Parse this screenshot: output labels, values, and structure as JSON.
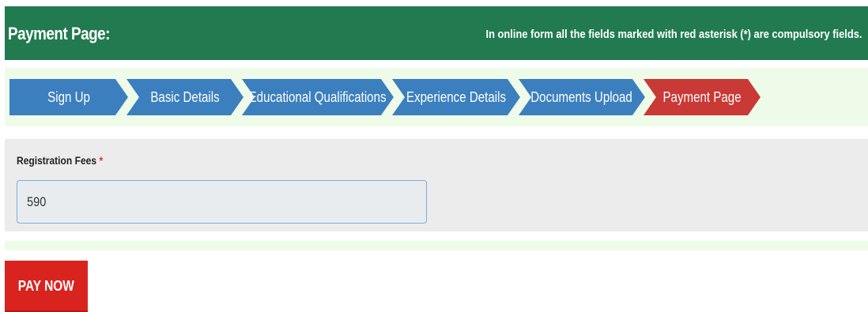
{
  "header": {
    "title": "Payment Page:",
    "note": "In online form all the fields marked with red asterisk (*) are compulsory fields."
  },
  "steps": [
    {
      "label": "Sign Up",
      "state": "completed"
    },
    {
      "label": "Basic Details",
      "state": "completed"
    },
    {
      "label": "Educational Qualifications",
      "state": "completed"
    },
    {
      "label": "Experience Details",
      "state": "completed"
    },
    {
      "label": "Documents Upload",
      "state": "completed"
    },
    {
      "label": "Payment Page",
      "state": "active"
    }
  ],
  "form": {
    "registration_fees_label": "Registration Fees",
    "required_marker": "*",
    "registration_fees_value": "590"
  },
  "actions": {
    "pay_now_label": "PAY NOW"
  },
  "colors": {
    "header_bg": "#217a50",
    "step_completed": "#3c7fbe",
    "step_active": "#c93935",
    "pay_button": "#d9231f"
  }
}
